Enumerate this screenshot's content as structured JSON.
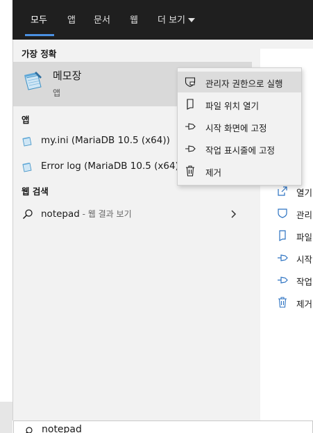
{
  "tabs": [
    {
      "label": "모두",
      "active": true
    },
    {
      "label": "앱",
      "active": false
    },
    {
      "label": "문서",
      "active": false
    },
    {
      "label": "웹",
      "active": false
    },
    {
      "label": "더 보기",
      "active": false
    }
  ],
  "best_match": {
    "heading": "가장 정확",
    "title": "메모장",
    "subtitle": "앱"
  },
  "apps": {
    "heading": "앱",
    "items": [
      {
        "label": "my.ini (MariaDB 10.5 (x64))"
      },
      {
        "label": "Error log (MariaDB 10.5 (x64))"
      }
    ]
  },
  "web": {
    "heading": "웹 검색",
    "query": "notepad",
    "suffix": " - 웹 결과 보기"
  },
  "context_menu": [
    {
      "label": "관리자 권한으로 실행",
      "icon": "shield-icon"
    },
    {
      "label": "파일 위치 열기",
      "icon": "file-icon"
    },
    {
      "label": "시작 화면에 고정",
      "icon": "pin-icon"
    },
    {
      "label": "작업 표시줄에 고정",
      "icon": "pin-icon"
    },
    {
      "label": "제거",
      "icon": "trash-icon"
    }
  ],
  "right_actions": [
    {
      "label": "열기",
      "icon": "open-icon"
    },
    {
      "label": "관리",
      "icon": "shield-icon"
    },
    {
      "label": "파일",
      "icon": "file-icon"
    },
    {
      "label": "시작",
      "icon": "pin-icon"
    },
    {
      "label": "작업",
      "icon": "pin-icon"
    },
    {
      "label": "제거",
      "icon": "trash-icon"
    }
  ],
  "search_box": {
    "value": "notepad"
  },
  "colors": {
    "accent": "#4a90e2",
    "tabbar": "#1f1f1f",
    "panel": "#f2f2f2",
    "selected": "#d9d9d9"
  }
}
